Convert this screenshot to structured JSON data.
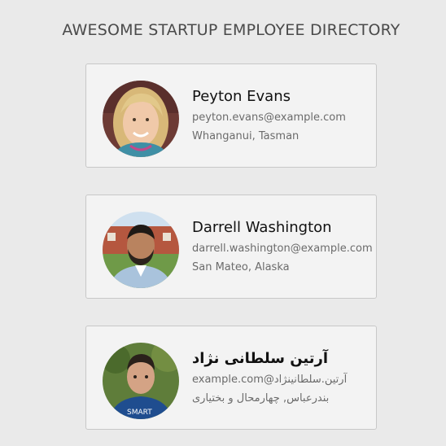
{
  "header": {
    "title": "AWESOME STARTUP EMPLOYEE DIRECTORY"
  },
  "employees": [
    {
      "name": "Peyton Evans",
      "email": "peyton.evans@example.com",
      "location": "Whanganui, Tasman",
      "avatar_icon": "person-photo-blonde-woman"
    },
    {
      "name": "Darrell Washington",
      "email": "darrell.washington@example.com",
      "location": "San Mateo, Alaska",
      "avatar_icon": "person-photo-bearded-man"
    },
    {
      "name": "آرتین سلطانی نژاد",
      "email": "آرتین.سلطانینژاد@example.com",
      "location": "بندرعباس, چهارمحال و بختیاری",
      "avatar_icon": "person-photo-young-man"
    }
  ]
}
